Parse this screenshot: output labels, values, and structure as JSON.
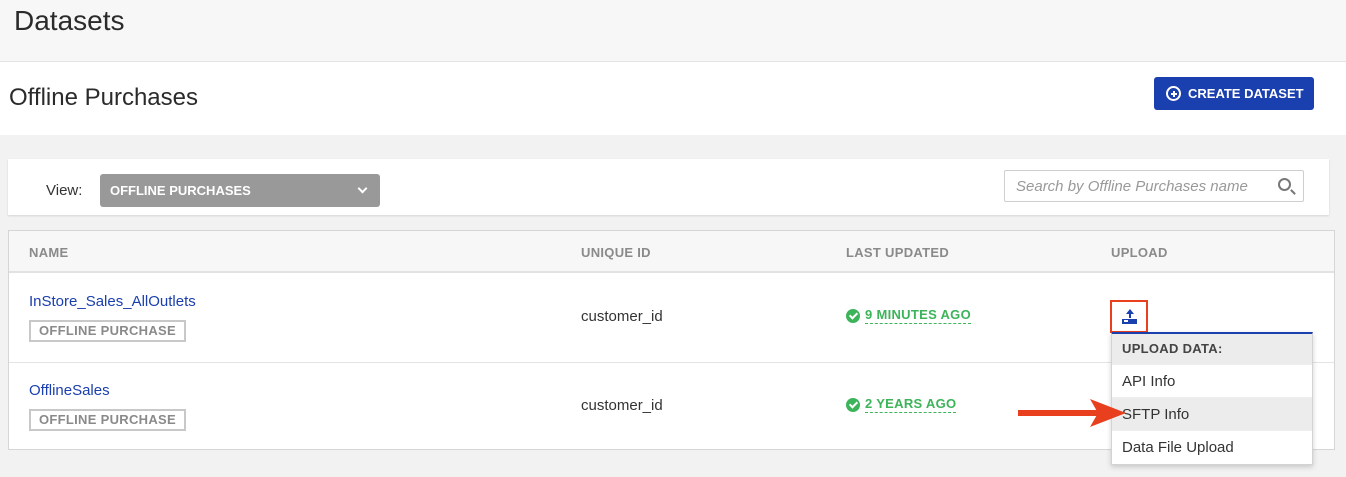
{
  "page": {
    "title": "Datasets"
  },
  "section": {
    "title": "Offline Purchases",
    "create_label": "CREATE DATASET"
  },
  "filter": {
    "view_label": "View:",
    "view_value": "OFFLINE PURCHASES",
    "search_placeholder": "Search by Offline Purchases name"
  },
  "table": {
    "columns": [
      "NAME",
      "UNIQUE ID",
      "LAST UPDATED",
      "UPLOAD"
    ],
    "rows": [
      {
        "name": "InStore_Sales_AllOutlets",
        "tag": "OFFLINE PURCHASE",
        "unique_id": "customer_id",
        "last_updated": "9 MINUTES AGO"
      },
      {
        "name": "OfflineSales",
        "tag": "OFFLINE PURCHASE",
        "unique_id": "customer_id",
        "last_updated": "2 YEARS AGO"
      }
    ]
  },
  "upload_menu": {
    "header": "UPLOAD DATA:",
    "items": [
      "API Info",
      "SFTP Info",
      "Data File Upload"
    ]
  },
  "colors": {
    "accent": "#1a3fae",
    "success": "#3db35a",
    "highlight": "#e8401e"
  },
  "icons": [
    "plus-circle-icon",
    "chevron-down-icon",
    "search-icon",
    "check-circle-icon",
    "upload-icon",
    "arrow-right-icon"
  ]
}
